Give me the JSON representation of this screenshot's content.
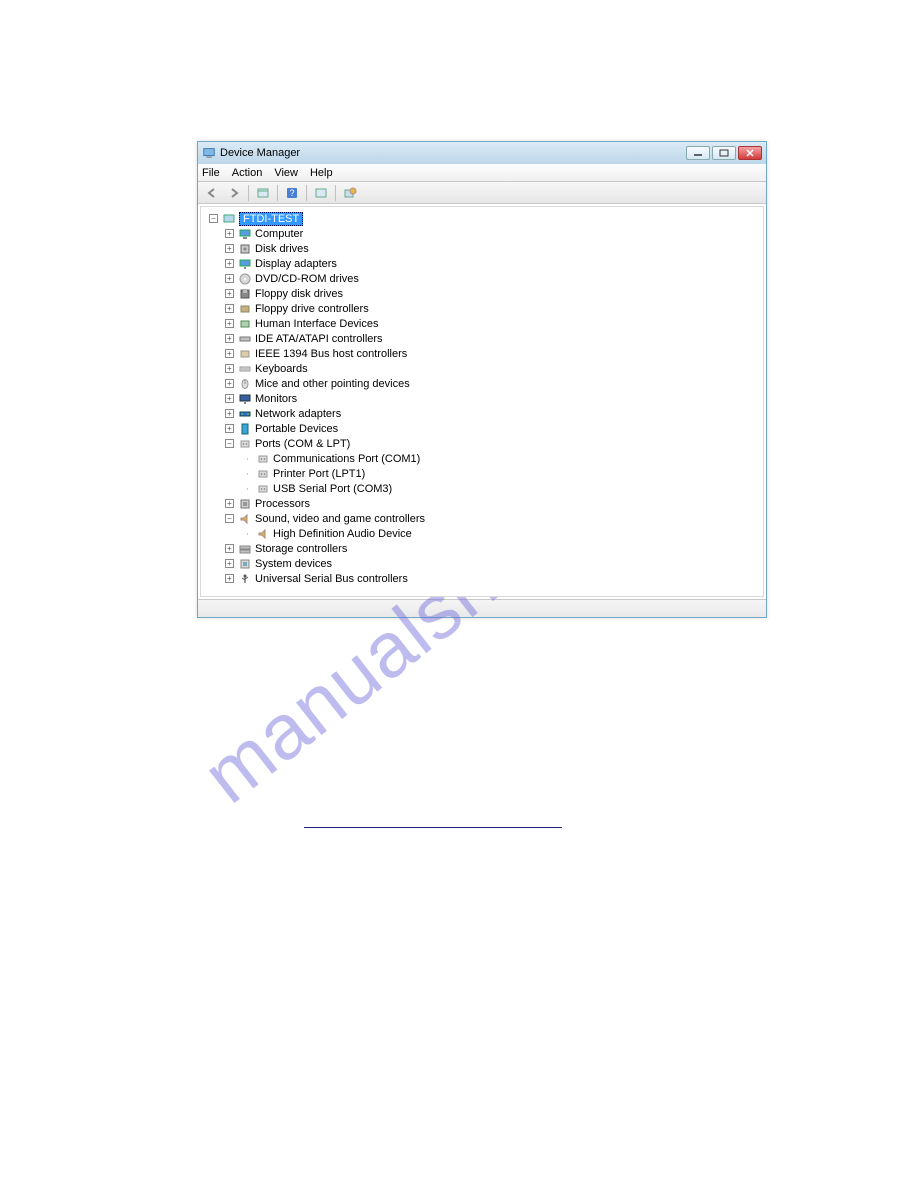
{
  "watermark": "manualshive.com",
  "window": {
    "title": "Device Manager"
  },
  "menu": {
    "file": "File",
    "action": "Action",
    "view": "View",
    "help": "Help"
  },
  "tree": {
    "root": "FTDI-TEST",
    "items": [
      {
        "label": "Computer",
        "icon": "computer",
        "children": null
      },
      {
        "label": "Disk drives",
        "icon": "disk",
        "children": null
      },
      {
        "label": "Display adapters",
        "icon": "display",
        "children": null
      },
      {
        "label": "DVD/CD-ROM drives",
        "icon": "cd",
        "children": null
      },
      {
        "label": "Floppy disk drives",
        "icon": "floppy",
        "children": null
      },
      {
        "label": "Floppy drive controllers",
        "icon": "floppyctrl",
        "children": null
      },
      {
        "label": "Human Interface Devices",
        "icon": "hid",
        "children": null
      },
      {
        "label": "IDE ATA/ATAPI controllers",
        "icon": "ide",
        "children": null
      },
      {
        "label": "IEEE 1394 Bus host controllers",
        "icon": "ieee1394",
        "children": null
      },
      {
        "label": "Keyboards",
        "icon": "keyboard",
        "children": null
      },
      {
        "label": "Mice and other pointing devices",
        "icon": "mouse",
        "children": null
      },
      {
        "label": "Monitors",
        "icon": "monitor",
        "children": null
      },
      {
        "label": "Network adapters",
        "icon": "network",
        "children": null
      },
      {
        "label": "Portable Devices",
        "icon": "portable",
        "children": null
      },
      {
        "label": "Ports (COM & LPT)",
        "icon": "port",
        "expanded": true,
        "children": [
          {
            "label": "Communications Port (COM1)",
            "icon": "port"
          },
          {
            "label": "Printer Port (LPT1)",
            "icon": "port"
          },
          {
            "label": "USB Serial Port (COM3)",
            "icon": "port"
          }
        ]
      },
      {
        "label": "Processors",
        "icon": "cpu",
        "children": null
      },
      {
        "label": "Sound, video and game controllers",
        "icon": "sound",
        "expanded": true,
        "children": [
          {
            "label": "High Definition Audio Device",
            "icon": "sound"
          }
        ]
      },
      {
        "label": "Storage controllers",
        "icon": "storage",
        "children": null
      },
      {
        "label": "System devices",
        "icon": "system",
        "children": null
      },
      {
        "label": "Universal Serial Bus controllers",
        "icon": "usb",
        "children": null
      }
    ]
  }
}
